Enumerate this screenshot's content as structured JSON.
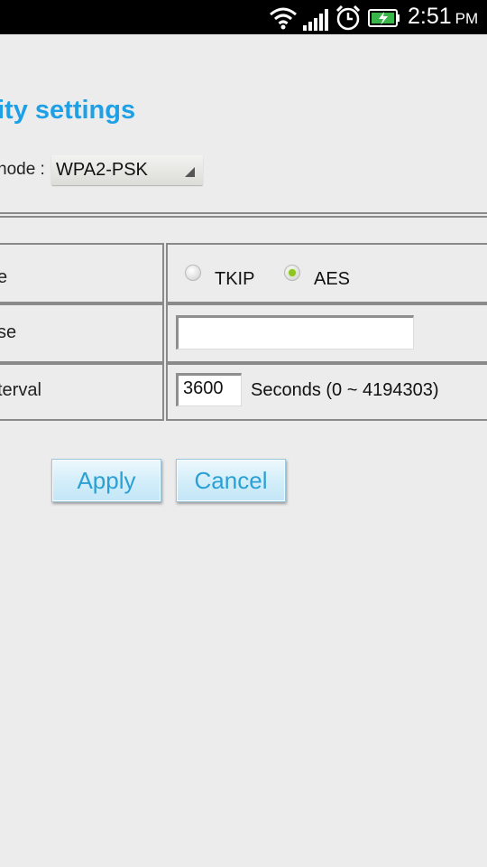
{
  "status_bar": {
    "time": "2:51",
    "ampm": "PM",
    "icons": [
      "wifi-icon",
      "signal-icon",
      "alarm-icon",
      "battery-charging-icon"
    ]
  },
  "page": {
    "title": "ity settings",
    "mode_label": "node :",
    "mode_value": "WPA2-PSK"
  },
  "table": {
    "rows": [
      {
        "label": "e"
      },
      {
        "label": "se"
      },
      {
        "label": "terval"
      }
    ],
    "cipher": {
      "options": [
        "TKIP",
        "AES"
      ],
      "selected": "AES"
    },
    "passphrase": {
      "value": ""
    },
    "interval": {
      "value": "3600",
      "unit": "Seconds (0 ~ 4194303)"
    }
  },
  "buttons": {
    "apply": "Apply",
    "cancel": "Cancel"
  },
  "colors": {
    "accent": "#1ea0e6",
    "button_text": "#2aa0d4",
    "radio_selected": "#8ec51e",
    "background": "#ececec"
  }
}
